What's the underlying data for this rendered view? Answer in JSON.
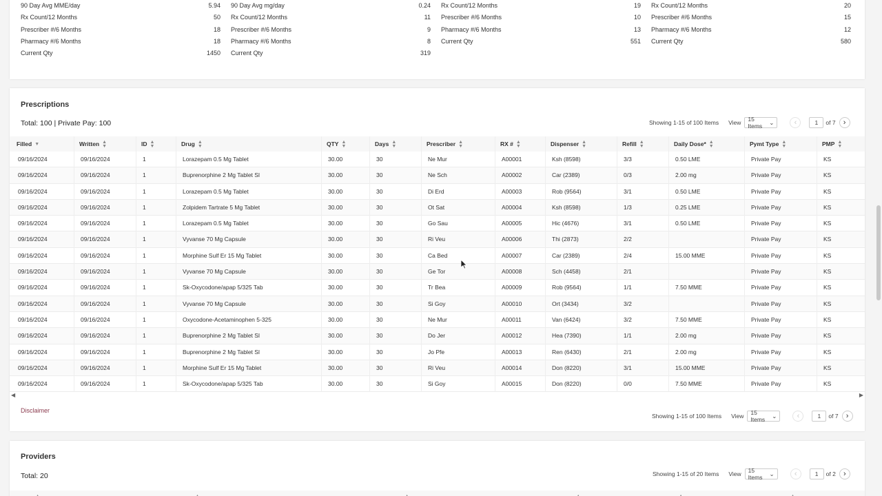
{
  "summary": [
    [
      [
        "90 Day Avg MME/day",
        "5.94"
      ],
      [
        "Rx Count/12 Months",
        "50"
      ],
      [
        "Prescriber #/6 Months",
        "18"
      ],
      [
        "Pharmacy #/6 Months",
        "18"
      ],
      [
        "Current Qty",
        "1450"
      ]
    ],
    [
      [
        "90 Day Avg mg/day",
        "0.24"
      ],
      [
        "Rx Count/12 Months",
        "11"
      ],
      [
        "Prescriber #/6 Months",
        "9"
      ],
      [
        "Pharmacy #/6 Months",
        "8"
      ],
      [
        "Current Qty",
        "319"
      ]
    ],
    [
      [
        "Rx Count/12 Months",
        "19"
      ],
      [
        "Prescriber #/6 Months",
        "10"
      ],
      [
        "Pharmacy #/6 Months",
        "13"
      ],
      [
        "Current Qty",
        "551"
      ]
    ],
    [
      [
        "Rx Count/12 Months",
        "20"
      ],
      [
        "Prescriber #/6 Months",
        "15"
      ],
      [
        "Pharmacy #/6 Months",
        "12"
      ],
      [
        "Current Qty",
        "580"
      ]
    ]
  ],
  "prescriptions": {
    "title": "Prescriptions",
    "total": "Total: 100 | Private Pay: 100",
    "pager_top": {
      "showing": "Showing 1-15 of 100 Items",
      "view": "View",
      "items": "15 Items",
      "page": "1",
      "of": "of 7"
    },
    "pager_bottom": {
      "showing": "Showing 1-15 of 100 Items",
      "view": "View",
      "items": "15 Items",
      "page": "1",
      "of": "of 7"
    },
    "columns": [
      "Filled",
      "Written",
      "ID",
      "Drug",
      "QTY",
      "Days",
      "Prescriber",
      "RX #",
      "Dispenser",
      "Refill",
      "Daily Dose*",
      "Pymt Type",
      "PMP"
    ],
    "rows": [
      [
        "09/16/2024",
        "09/16/2024",
        "1",
        "Lorazepam 0.5 Mg Tablet",
        "30.00",
        "30",
        "Ne Mur",
        "A00001",
        "Ksh (8598)",
        "3/3",
        "0.50 LME",
        "Private Pay",
        "KS"
      ],
      [
        "09/16/2024",
        "09/16/2024",
        "1",
        "Buprenorphine 2 Mg Tablet Sl",
        "30.00",
        "30",
        "Ne Sch",
        "A00002",
        "Car (2389)",
        "0/3",
        "2.00 mg",
        "Private Pay",
        "KS"
      ],
      [
        "09/16/2024",
        "09/16/2024",
        "1",
        "Lorazepam 0.5 Mg Tablet",
        "30.00",
        "30",
        "Di Erd",
        "A00003",
        "Rob (9564)",
        "3/1",
        "0.50 LME",
        "Private Pay",
        "KS"
      ],
      [
        "09/16/2024",
        "09/16/2024",
        "1",
        "Zolpidem Tartrate 5 Mg Tablet",
        "30.00",
        "30",
        "Ot Sat",
        "A00004",
        "Ksh (8598)",
        "1/3",
        "0.25 LME",
        "Private Pay",
        "KS"
      ],
      [
        "09/16/2024",
        "09/16/2024",
        "1",
        "Lorazepam 0.5 Mg Tablet",
        "30.00",
        "30",
        "Go Sau",
        "A00005",
        "Hic (4676)",
        "3/1",
        "0.50 LME",
        "Private Pay",
        "KS"
      ],
      [
        "09/16/2024",
        "09/16/2024",
        "1",
        "Vyvanse 70 Mg Capsule",
        "30.00",
        "30",
        "Ri Veu",
        "A00006",
        "Thi (2873)",
        "2/2",
        "",
        "Private Pay",
        "KS"
      ],
      [
        "09/16/2024",
        "09/16/2024",
        "1",
        "Morphine Sulf Er 15 Mg Tablet",
        "30.00",
        "30",
        "Ca Bed",
        "A00007",
        "Car (2389)",
        "2/4",
        "15.00 MME",
        "Private Pay",
        "KS"
      ],
      [
        "09/16/2024",
        "09/16/2024",
        "1",
        "Vyvanse 70 Mg Capsule",
        "30.00",
        "30",
        "Ge Tor",
        "A00008",
        "Sch (4458)",
        "2/1",
        "",
        "Private Pay",
        "KS"
      ],
      [
        "09/16/2024",
        "09/16/2024",
        "1",
        "Sk-Oxycodone/apap 5/325 Tab",
        "30.00",
        "30",
        "Tr Bea",
        "A00009",
        "Rob (9564)",
        "1/1",
        "7.50 MME",
        "Private Pay",
        "KS"
      ],
      [
        "09/16/2024",
        "09/16/2024",
        "1",
        "Vyvanse 70 Mg Capsule",
        "30.00",
        "30",
        "Si Goy",
        "A00010",
        "Ort (3434)",
        "3/2",
        "",
        "Private Pay",
        "KS"
      ],
      [
        "09/16/2024",
        "09/16/2024",
        "1",
        "Oxycodone-Acetaminophen 5-325",
        "30.00",
        "30",
        "Ne Mur",
        "A00011",
        "Van (6424)",
        "3/2",
        "7.50 MME",
        "Private Pay",
        "KS"
      ],
      [
        "09/16/2024",
        "09/16/2024",
        "1",
        "Buprenorphine 2 Mg Tablet Sl",
        "30.00",
        "30",
        "Do Jer",
        "A00012",
        "Hea (7390)",
        "1/1",
        "2.00 mg",
        "Private Pay",
        "KS"
      ],
      [
        "09/16/2024",
        "09/16/2024",
        "1",
        "Buprenorphine 2 Mg Tablet Sl",
        "30.00",
        "30",
        "Jo Pfe",
        "A00013",
        "Ren (6430)",
        "2/1",
        "2.00 mg",
        "Private Pay",
        "KS"
      ],
      [
        "09/16/2024",
        "09/16/2024",
        "1",
        "Morphine Sulf Er 15 Mg Tablet",
        "30.00",
        "30",
        "Ri Veu",
        "A00014",
        "Don (8220)",
        "3/1",
        "15.00 MME",
        "Private Pay",
        "KS"
      ],
      [
        "09/16/2024",
        "09/16/2024",
        "1",
        "Sk-Oxycodone/apap 5/325 Tab",
        "30.00",
        "30",
        "Si Goy",
        "A00015",
        "Don (8220)",
        "0/0",
        "7.50 MME",
        "Private Pay",
        "KS"
      ]
    ],
    "disclaimer": "Disclaimer"
  },
  "providers": {
    "title": "Providers",
    "total": "Total: 20",
    "pager": {
      "showing": "Showing 1-15 of 20 Items",
      "view": "View",
      "items": "15 Items",
      "page": "1",
      "of": "of 2"
    },
    "columns": [
      "Name",
      "Address",
      "City",
      "State",
      "Zipcode",
      "Phone"
    ]
  },
  "icons": {
    "sort": "sort-icon",
    "chevron_down": "chevron-down-icon",
    "prev": "chevron-left-icon",
    "next": "chevron-right-icon"
  }
}
